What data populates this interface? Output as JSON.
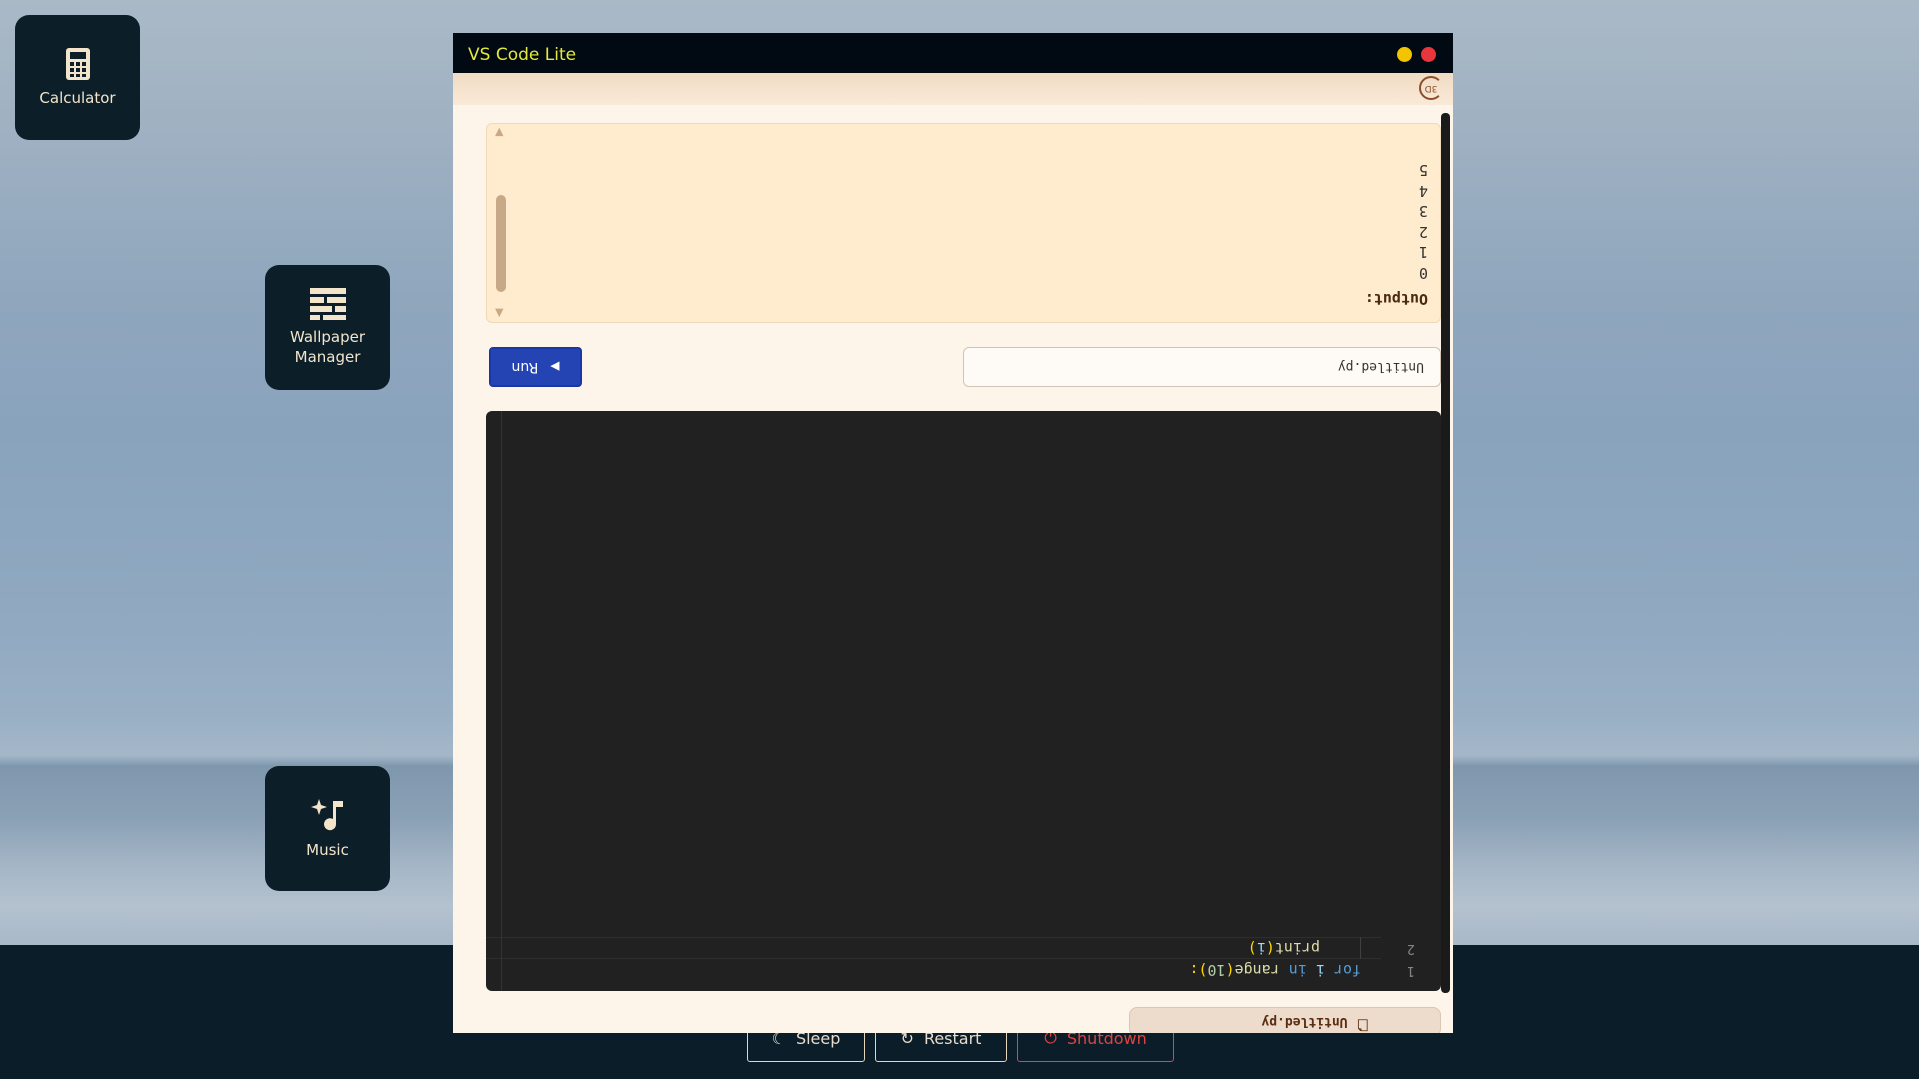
{
  "desktop": {
    "icons": [
      {
        "label": "Calculator"
      },
      {
        "label": "Wallpaper Manager"
      },
      {
        "label": "Music"
      }
    ]
  },
  "taskbar": {
    "sleep_label": "Sleep",
    "restart_label": "Restart",
    "shutdown_label": "Shutdown"
  },
  "window": {
    "title": "VS Code Lite",
    "title_color": "#e2ea3b",
    "tab_label": "Untitled.py",
    "filename_value": "Untitled.py",
    "run_label": "Run",
    "view_badge": "3D",
    "editor": {
      "lines": [
        {
          "number": "1",
          "kw1": "for",
          "var": "i",
          "kw2": "in",
          "fn": "range",
          "open": "(",
          "num": "10",
          "close": "):"
        },
        {
          "number": "2",
          "fn": "print",
          "open": "(",
          "var": "i",
          "close": ")"
        }
      ]
    },
    "output": {
      "label": "Output:",
      "lines": [
        "0",
        "1",
        "2",
        "3",
        "4",
        "5"
      ]
    }
  }
}
